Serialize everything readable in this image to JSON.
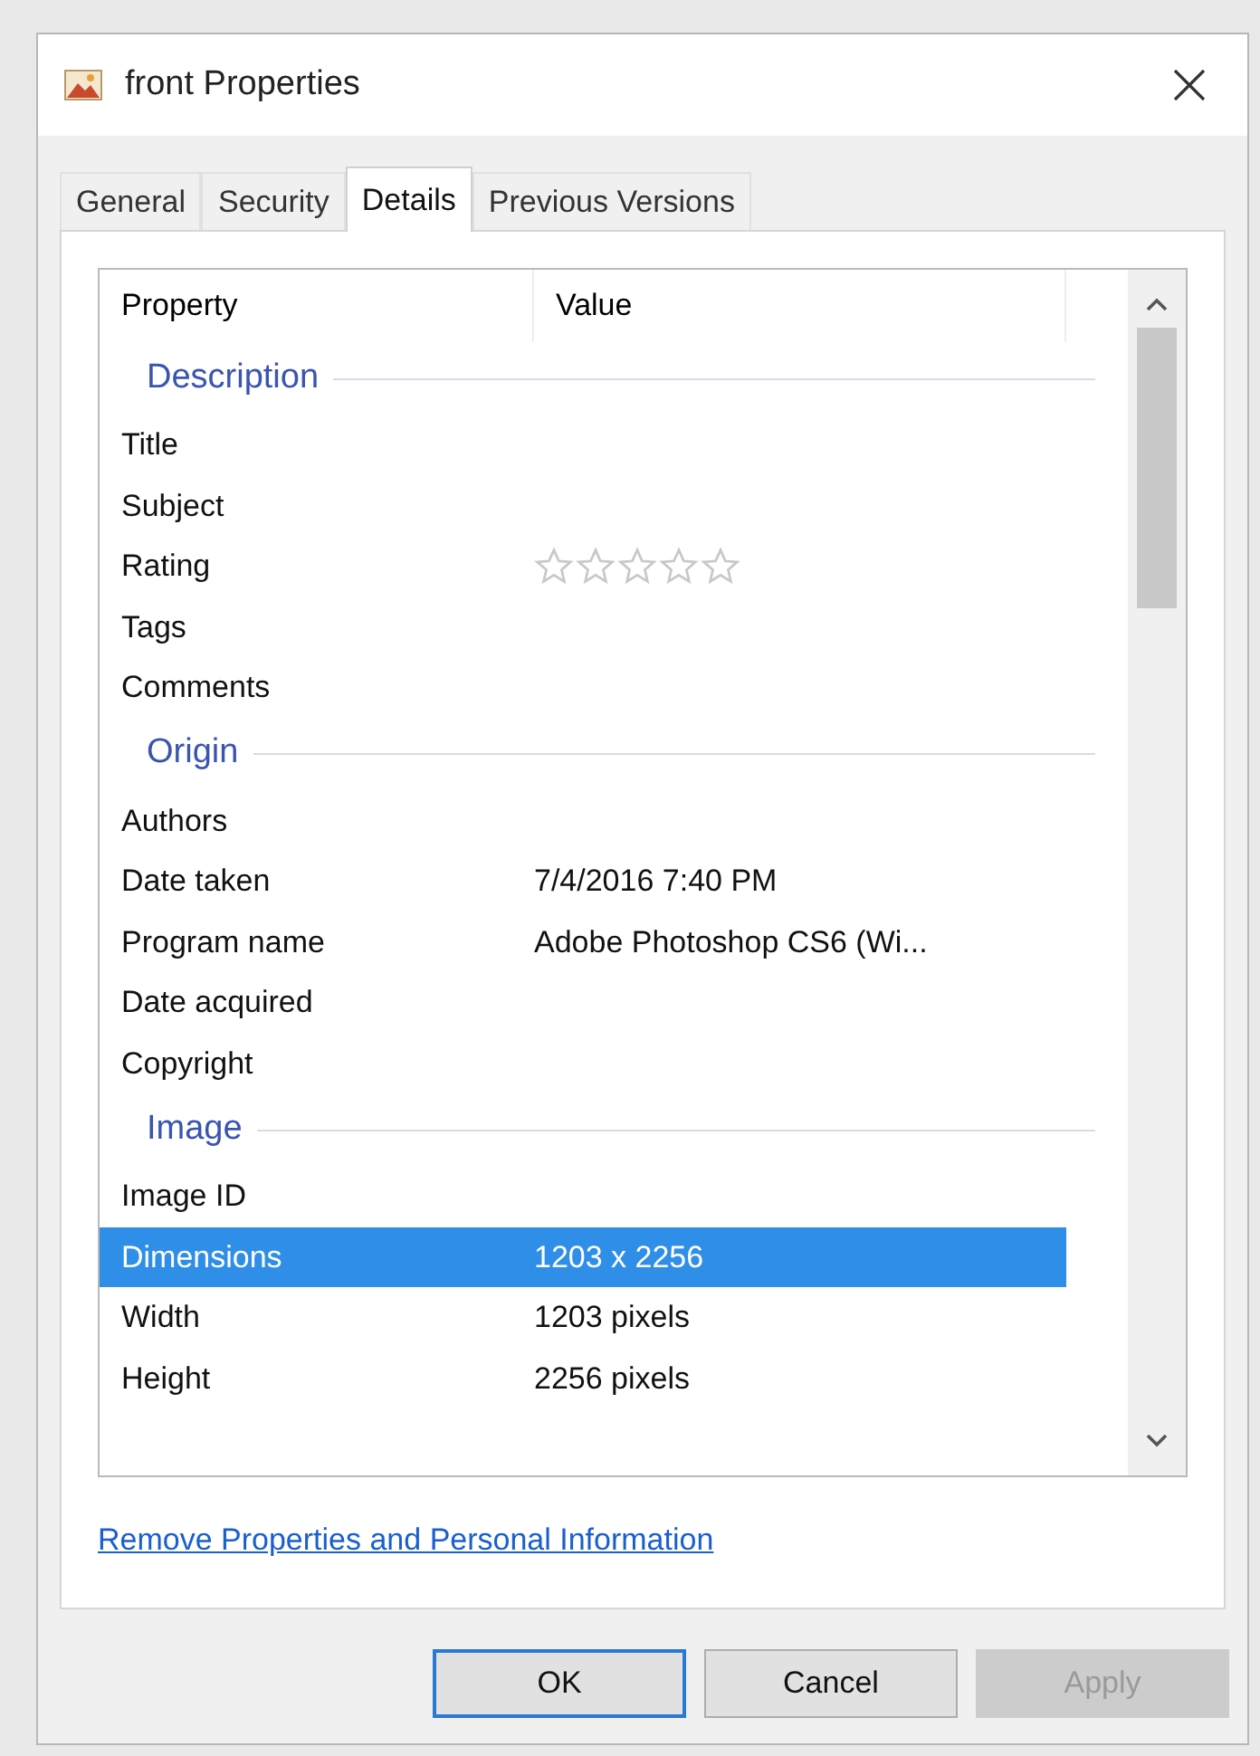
{
  "window": {
    "title": "front Properties"
  },
  "tabs": [
    {
      "label": "General",
      "selected": false
    },
    {
      "label": "Security",
      "selected": false
    },
    {
      "label": "Details",
      "selected": true
    },
    {
      "label": "Previous Versions",
      "selected": false
    }
  ],
  "table": {
    "columns": [
      "Property",
      "Value"
    ],
    "rows": [
      {
        "kind": "section",
        "label": "Description"
      },
      {
        "kind": "row",
        "property": "Title",
        "selected": false
      },
      {
        "kind": "row",
        "property": "Subject",
        "selected": false
      },
      {
        "kind": "rating",
        "property": "Rating",
        "stars": 0,
        "selected": false
      },
      {
        "kind": "row",
        "property": "Tags",
        "selected": false
      },
      {
        "kind": "row",
        "property": "Comments",
        "selected": false
      },
      {
        "kind": "section",
        "label": "Origin"
      },
      {
        "kind": "row",
        "property": "Authors",
        "selected": false
      },
      {
        "kind": "row",
        "property": "Date taken",
        "value": "7/4/2016 7:40 PM",
        "selected": false
      },
      {
        "kind": "row",
        "property": "Program name",
        "value": "Adobe Photoshop CS6 (Wi...",
        "selected": false
      },
      {
        "kind": "row",
        "property": "Date acquired",
        "selected": false
      },
      {
        "kind": "row",
        "property": "Copyright",
        "selected": false
      },
      {
        "kind": "section",
        "label": "Image"
      },
      {
        "kind": "row",
        "property": "Image ID",
        "selected": false
      },
      {
        "kind": "row",
        "property": "Dimensions",
        "value": "1203 x 2256",
        "selected": true
      },
      {
        "kind": "row",
        "property": "Width",
        "value": "1203 pixels",
        "selected": false
      },
      {
        "kind": "row",
        "property": "Height",
        "value": "2256 pixels",
        "selected": false
      }
    ]
  },
  "link": "Remove Properties and Personal Information",
  "buttons": [
    {
      "label": "OK",
      "disabled": false,
      "default": true
    },
    {
      "label": "Cancel",
      "disabled": false,
      "default": false
    },
    {
      "label": "Apply",
      "disabled": true,
      "default": false
    }
  ]
}
